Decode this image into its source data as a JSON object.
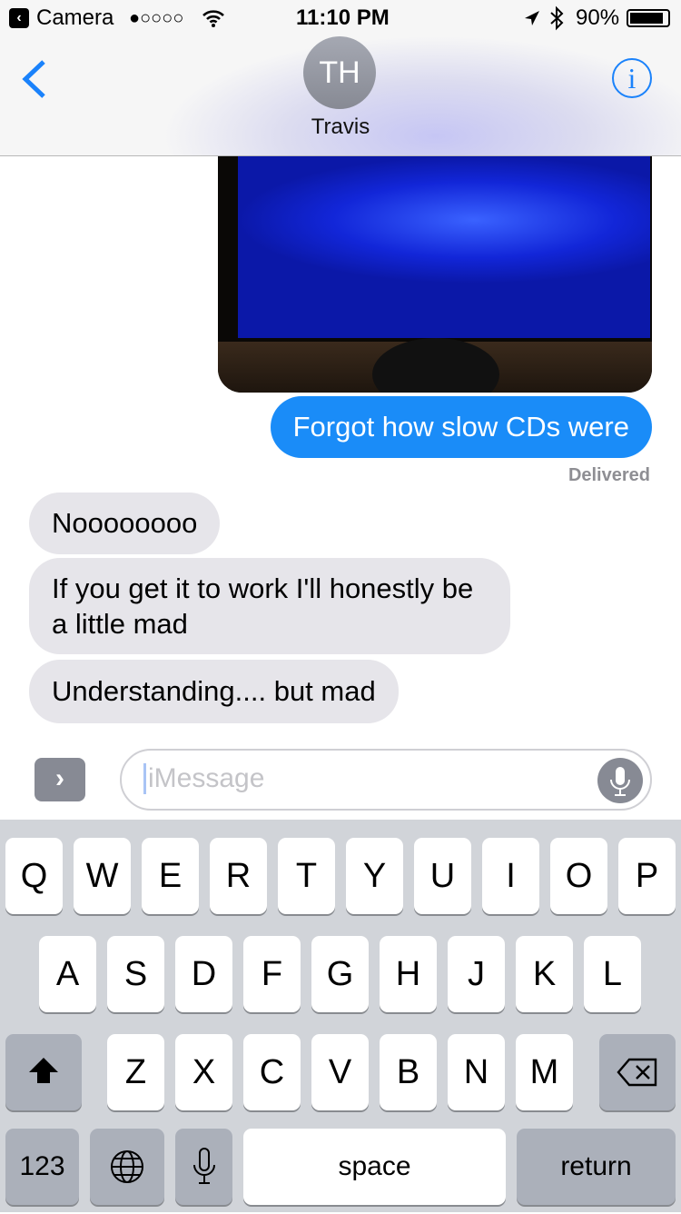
{
  "status": {
    "back_app": "Camera",
    "signal": "●○○○○",
    "time": "11:10 PM",
    "battery": "90%"
  },
  "nav": {
    "initials": "TH",
    "name": "Travis",
    "info": "i"
  },
  "messages": {
    "sent": [
      "Forgot how slow CDs were"
    ],
    "delivered": "Delivered",
    "received": [
      "Noooooooo",
      "If you get it to work I'll honestly be a little mad",
      "Understanding.... but mad"
    ]
  },
  "compose": {
    "placeholder": "iMessage",
    "expand": "›"
  },
  "keyboard": {
    "row1": [
      "Q",
      "W",
      "E",
      "R",
      "T",
      "Y",
      "U",
      "I",
      "O",
      "P"
    ],
    "row2": [
      "A",
      "S",
      "D",
      "F",
      "G",
      "H",
      "J",
      "K",
      "L"
    ],
    "row3": [
      "Z",
      "X",
      "C",
      "V",
      "B",
      "N",
      "M"
    ],
    "numbers": "123",
    "space": "space",
    "return": "return"
  }
}
